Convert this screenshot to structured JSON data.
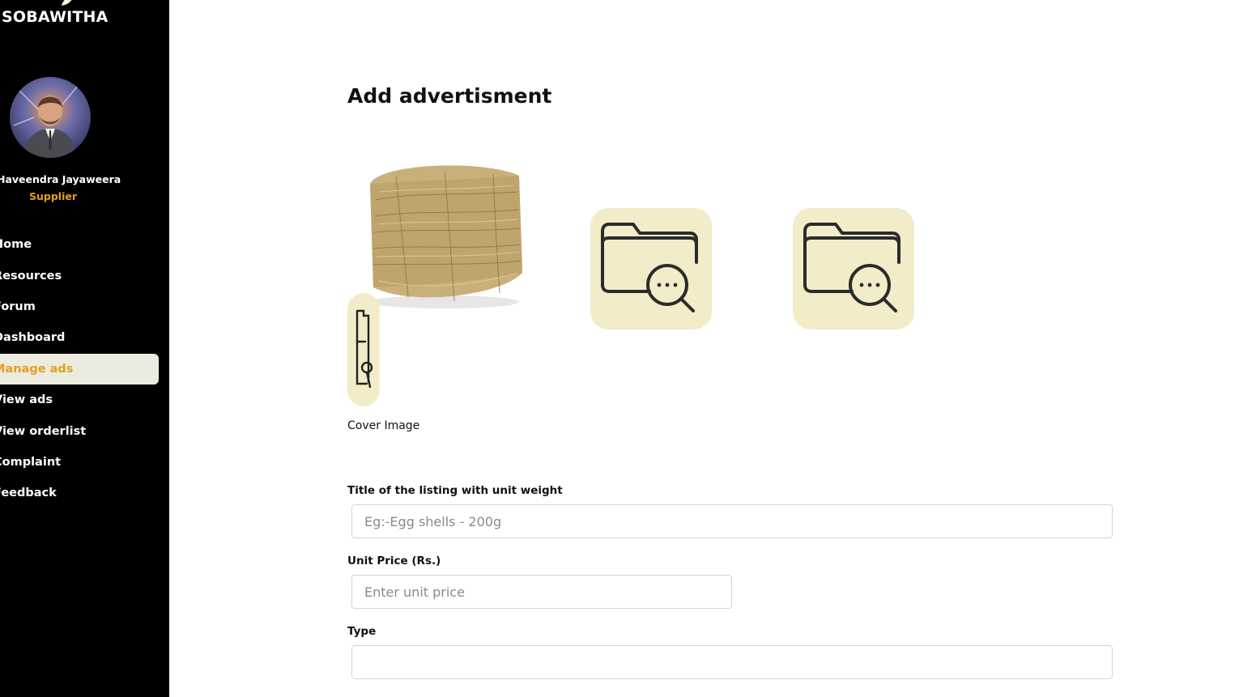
{
  "brand": {
    "name": "SOBAWITHA"
  },
  "user": {
    "name": "Haveendra Jayaweera",
    "role": "Supplier"
  },
  "nav": {
    "items": [
      {
        "label": "Home"
      },
      {
        "label": "Resources"
      },
      {
        "label": "Forum"
      },
      {
        "label": "Dashboard"
      },
      {
        "label": "Manage ads",
        "active": true
      },
      {
        "label": "View ads"
      },
      {
        "label": "View orderlist"
      },
      {
        "label": "Complaint"
      },
      {
        "label": "Feedback"
      }
    ]
  },
  "main": {
    "title": "Add advertisment",
    "cover_label": "Cover Image",
    "fields": {
      "title": {
        "label": "Title of the listing with unit weight",
        "placeholder": "Eg:-Egg shells - 200g",
        "value": ""
      },
      "price": {
        "label": "Unit Price (Rs.)",
        "placeholder": "Enter unit price",
        "value": ""
      },
      "type": {
        "label": "Type",
        "value": ""
      }
    }
  },
  "colors": {
    "sidebar_bg": "#000000",
    "accent": "#e0a020",
    "tile_bg": "#f2ecc8",
    "active_nav_bg": "#ecebe0"
  },
  "icons": [
    "leaf-icon",
    "folder-search-icon"
  ]
}
